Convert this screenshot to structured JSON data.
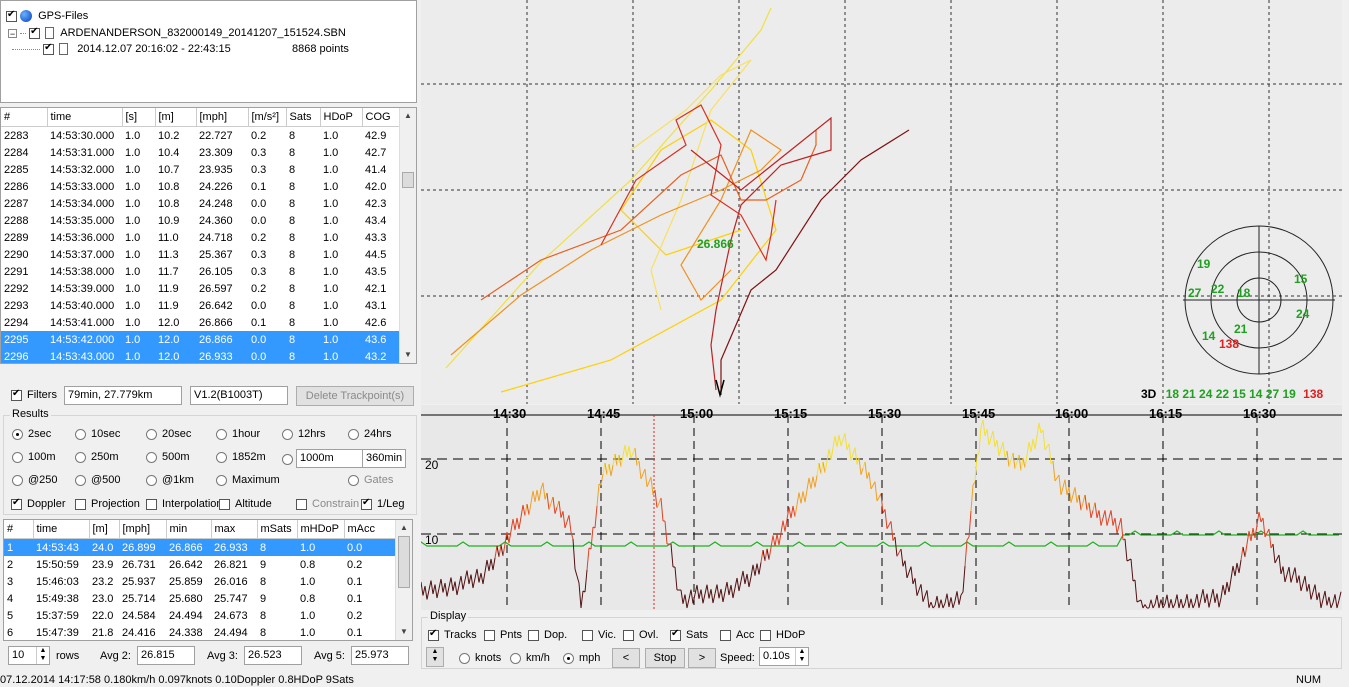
{
  "tree": {
    "root": "GPS-Files",
    "file": "ARDENANDERSON_832000149_20141207_151524.SBN",
    "segment": "2014.12.07 20:16:02 - 22:43:15",
    "points": "8868 points"
  },
  "points_table": {
    "headers": [
      "#",
      "time",
      "[s]",
      "[m]",
      "[mph]",
      "[m/s²]",
      "Sats",
      "HDoP",
      "COG"
    ],
    "rows": [
      [
        "2283",
        "14:53:30.000",
        "1.0",
        "10.2",
        "22.727",
        "0.2",
        "8",
        "1.0",
        "42.9"
      ],
      [
        "2284",
        "14:53:31.000",
        "1.0",
        "10.4",
        "23.309",
        "0.3",
        "8",
        "1.0",
        "42.7"
      ],
      [
        "2285",
        "14:53:32.000",
        "1.0",
        "10.7",
        "23.935",
        "0.3",
        "8",
        "1.0",
        "41.4"
      ],
      [
        "2286",
        "14:53:33.000",
        "1.0",
        "10.8",
        "24.226",
        "0.1",
        "8",
        "1.0",
        "42.0"
      ],
      [
        "2287",
        "14:53:34.000",
        "1.0",
        "10.8",
        "24.248",
        "0.0",
        "8",
        "1.0",
        "42.3"
      ],
      [
        "2288",
        "14:53:35.000",
        "1.0",
        "10.9",
        "24.360",
        "0.0",
        "8",
        "1.0",
        "43.4"
      ],
      [
        "2289",
        "14:53:36.000",
        "1.0",
        "11.0",
        "24.718",
        "0.2",
        "8",
        "1.0",
        "43.3"
      ],
      [
        "2290",
        "14:53:37.000",
        "1.0",
        "11.3",
        "25.367",
        "0.3",
        "8",
        "1.0",
        "44.5"
      ],
      [
        "2291",
        "14:53:38.000",
        "1.0",
        "11.7",
        "26.105",
        "0.3",
        "8",
        "1.0",
        "43.5"
      ],
      [
        "2292",
        "14:53:39.000",
        "1.0",
        "11.9",
        "26.597",
        "0.2",
        "8",
        "1.0",
        "42.1"
      ],
      [
        "2293",
        "14:53:40.000",
        "1.0",
        "11.9",
        "26.642",
        "0.0",
        "8",
        "1.0",
        "43.1"
      ],
      [
        "2294",
        "14:53:41.000",
        "1.0",
        "12.0",
        "26.866",
        "0.1",
        "8",
        "1.0",
        "42.6"
      ],
      [
        "2295",
        "14:53:42.000",
        "1.0",
        "12.0",
        "26.866",
        "0.0",
        "8",
        "1.0",
        "43.6"
      ],
      [
        "2296",
        "14:53:43.000",
        "1.0",
        "12.0",
        "26.933",
        "0.0",
        "8",
        "1.0",
        "43.2"
      ]
    ],
    "selected_index": 12
  },
  "filters": {
    "label": "Filters",
    "summary": "79min, 27.779km",
    "version": "V1.2(B1003T)",
    "delete_label": "Delete Trackpoint(s)"
  },
  "results": {
    "title": "Results",
    "row1": [
      "2sec",
      "10sec",
      "20sec",
      "1hour",
      "12hrs",
      "24hrs"
    ],
    "row2": [
      "100m",
      "250m",
      "500m",
      "1852m"
    ],
    "custom_dist": "1000m",
    "custom_time": "360min",
    "row3": [
      "@250",
      "@500",
      "@1km",
      "Maximum"
    ],
    "gates": "Gates",
    "row4": [
      "Doppler",
      "Projection",
      "Interpolation",
      "Altitude",
      "Constrain",
      "1/Leg"
    ]
  },
  "results_table": {
    "headers": [
      "#",
      "time",
      "[m]",
      "[mph]",
      "min",
      "max",
      "mSats",
      "mHDoP",
      "mAcc"
    ],
    "rows": [
      [
        "1",
        "14:53:43",
        "24.0",
        "26.899",
        "26.866",
        "26.933",
        "8",
        "1.0",
        "0.0"
      ],
      [
        "2",
        "15:50:59",
        "23.9",
        "26.731",
        "26.642",
        "26.821",
        "9",
        "0.8",
        "0.2"
      ],
      [
        "3",
        "15:46:03",
        "23.2",
        "25.937",
        "25.859",
        "26.016",
        "8",
        "1.0",
        "0.1"
      ],
      [
        "4",
        "15:49:38",
        "23.0",
        "25.714",
        "25.680",
        "25.747",
        "9",
        "0.8",
        "0.1"
      ],
      [
        "5",
        "15:37:59",
        "22.0",
        "24.584",
        "24.494",
        "24.673",
        "8",
        "1.0",
        "0.2"
      ],
      [
        "6",
        "15:47:39",
        "21.8",
        "24.416",
        "24.338",
        "24.494",
        "8",
        "1.0",
        "0.1"
      ]
    ]
  },
  "footer": {
    "rows_value": "10",
    "rows_label": "rows",
    "avg2_label": "Avg 2:",
    "avg2": "26.815",
    "avg3_label": "Avg 3:",
    "avg3": "26.523",
    "avg5_label": "Avg 5:",
    "avg5": "25.973"
  },
  "map": {
    "speed_label": "26.866",
    "sat_numbers": [
      "19",
      "15",
      "27",
      "22",
      "18",
      "24",
      "21",
      "14",
      "138"
    ],
    "sat_summary_prefix": "3D",
    "sat_summary_green": "18 21 24 22 15 14 27 19",
    "sat_summary_red": "138"
  },
  "speed_chart": {
    "time_labels": [
      "14:30",
      "14:45",
      "15:00",
      "15:15",
      "15:30",
      "15:45",
      "16:00",
      "16:15",
      "16:30"
    ],
    "y_labels": [
      "20",
      "10"
    ]
  },
  "display": {
    "title": "Display",
    "checks": [
      {
        "label": "Tracks",
        "on": true
      },
      {
        "label": "Pnts",
        "on": false
      },
      {
        "label": "Dop.",
        "on": false
      },
      {
        "label": "Vic.",
        "on": false
      },
      {
        "label": "Ovl.",
        "on": false
      },
      {
        "label": "Sats",
        "on": true
      },
      {
        "label": "Acc",
        "on": false
      },
      {
        "label": "HDoP",
        "on": false
      }
    ],
    "units": [
      "knots",
      "km/h",
      "mph"
    ],
    "unit_selected": "mph",
    "prev_label": "<",
    "stop_label": "Stop",
    "next_label": ">",
    "speed_label": "Speed:",
    "speed_value": "0.10s"
  },
  "status": {
    "text": "07.12.2014 14:17:58  0.180km/h  0.097knots  0.10Doppler  0.8HDoP  9Sats",
    "num": "NUM"
  }
}
